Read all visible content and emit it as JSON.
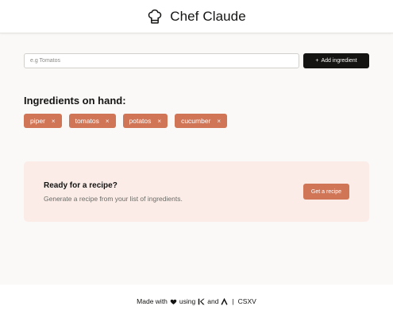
{
  "header": {
    "title": "Chef Claude",
    "icon": "chef-hat-icon"
  },
  "form": {
    "input_value": "",
    "input_placeholder": "e.g Tomatos",
    "add_button_label": "Add ingredient",
    "add_button_icon": "+"
  },
  "ingredients": {
    "title": "Ingredients on hand:",
    "items": [
      {
        "label": "piper",
        "remove": "×"
      },
      {
        "label": "tomatos",
        "remove": "×"
      },
      {
        "label": "potatos",
        "remove": "×"
      },
      {
        "label": "cucumber",
        "remove": "×"
      }
    ]
  },
  "recipe_card": {
    "title": "Ready for a recipe?",
    "subtitle": "Generate a recipe from your list of ingredients.",
    "button_label": "Get a recipe"
  },
  "footer": {
    "made_with": "Made with",
    "using": "using",
    "and": "and",
    "separator": "|",
    "credit": "CSXV"
  },
  "colors": {
    "accent": "#d17557",
    "card_bg": "#fbece7",
    "dark_button": "#141413",
    "page_bg": "#faf9f7"
  }
}
